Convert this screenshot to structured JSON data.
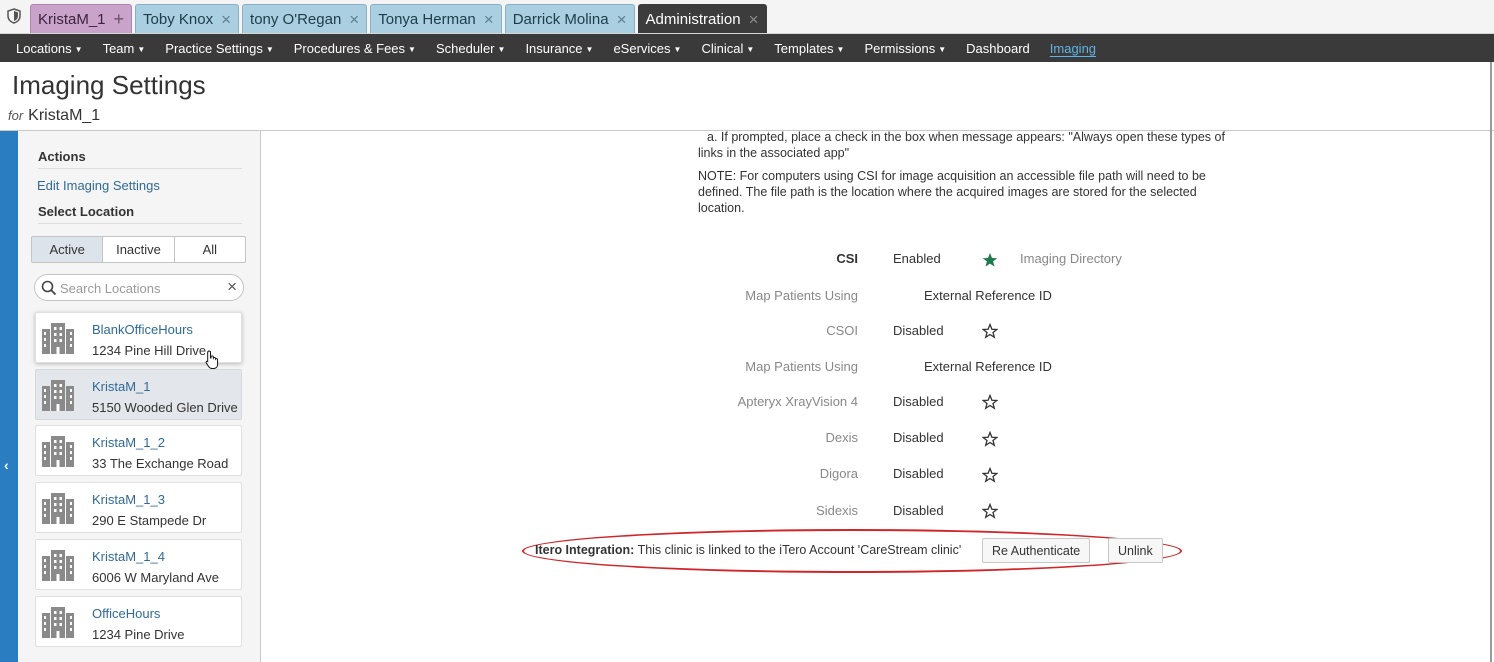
{
  "tabs": [
    {
      "label": "KristaM_1",
      "close": "+"
    },
    {
      "label": "Toby Knox",
      "close": "×"
    },
    {
      "label": "tony O'Regan",
      "close": "×"
    },
    {
      "label": "Tonya Herman",
      "close": "×"
    },
    {
      "label": "Darrick Molina",
      "close": "×"
    },
    {
      "label": "Administration",
      "close": "×"
    }
  ],
  "nav": [
    {
      "label": "Locations",
      "dropdown": true
    },
    {
      "label": "Team",
      "dropdown": true
    },
    {
      "label": "Practice Settings",
      "dropdown": true
    },
    {
      "label": "Procedures & Fees",
      "dropdown": true
    },
    {
      "label": "Scheduler",
      "dropdown": true
    },
    {
      "label": "Insurance",
      "dropdown": true
    },
    {
      "label": "eServices",
      "dropdown": true
    },
    {
      "label": "Clinical",
      "dropdown": true
    },
    {
      "label": "Templates",
      "dropdown": true
    },
    {
      "label": "Permissions",
      "dropdown": true
    },
    {
      "label": "Dashboard",
      "dropdown": false
    },
    {
      "label": "Imaging",
      "dropdown": false,
      "active": true
    }
  ],
  "caret": "▼",
  "header": {
    "title": "Imaging Settings",
    "for_label": "for",
    "location": "KristaM_1"
  },
  "sidebar": {
    "actions_heading": "Actions",
    "edit_link": "Edit Imaging Settings",
    "select_heading": "Select Location",
    "filter": {
      "active": "Active",
      "inactive": "Inactive",
      "all": "All",
      "selected": "Active"
    },
    "search": {
      "placeholder": "Search Locations",
      "value": "",
      "clear": "×"
    },
    "locations": [
      {
        "name": "BlankOfficeHours",
        "address": "1234 Pine Hill Drive"
      },
      {
        "name": "KristaM_1",
        "address": "5150 Wooded Glen Drive",
        "selected": true
      },
      {
        "name": "KristaM_1_2",
        "address": "33 The Exchange Road"
      },
      {
        "name": "KristaM_1_3",
        "address": "290 E Stampede Dr"
      },
      {
        "name": "KristaM_1_4",
        "address": "6006 W Maryland Ave"
      },
      {
        "name": "OfficeHours",
        "address": "1234 Pine Drive"
      }
    ],
    "collapse_icon": "‹"
  },
  "content": {
    "instruction_a": "a. If prompted, place a check in the box when message appears: \"Always open these types of links in the associated app\"",
    "note": "NOTE: For computers using CSI for image acquisition an accessible file path will need to be defined. The file path is the location where the acquired images are stored for the selected location.",
    "csi": {
      "label": "CSI",
      "status": "Enabled",
      "default": true,
      "extra": "Imaging Directory"
    },
    "csi_map": {
      "label": "Map Patients Using",
      "value": "External Reference ID"
    },
    "csoi": {
      "label": "CSOI",
      "status": "Disabled",
      "default": false
    },
    "csoi_map": {
      "label": "Map Patients Using",
      "value": "External Reference ID"
    },
    "apteryx": {
      "label": "Apteryx XrayVision 4",
      "status": "Disabled",
      "default": false
    },
    "dexis": {
      "label": "Dexis",
      "status": "Disabled",
      "default": false
    },
    "digora": {
      "label": "Digora",
      "status": "Disabled",
      "default": false
    },
    "sidexis": {
      "label": "Sidexis",
      "status": "Disabled",
      "default": false
    },
    "itero": {
      "label": "Itero Integration:",
      "message": "This clinic is linked to the iTero Account 'CareStream clinic'",
      "reauth": "Re Authenticate",
      "unlink": "Unlink"
    }
  },
  "colors": {
    "accent": "#2a7dc1",
    "star_filled": "#1e7a4f",
    "highlight_ring": "#d0262a",
    "nav_bg": "#3a3a3a"
  }
}
